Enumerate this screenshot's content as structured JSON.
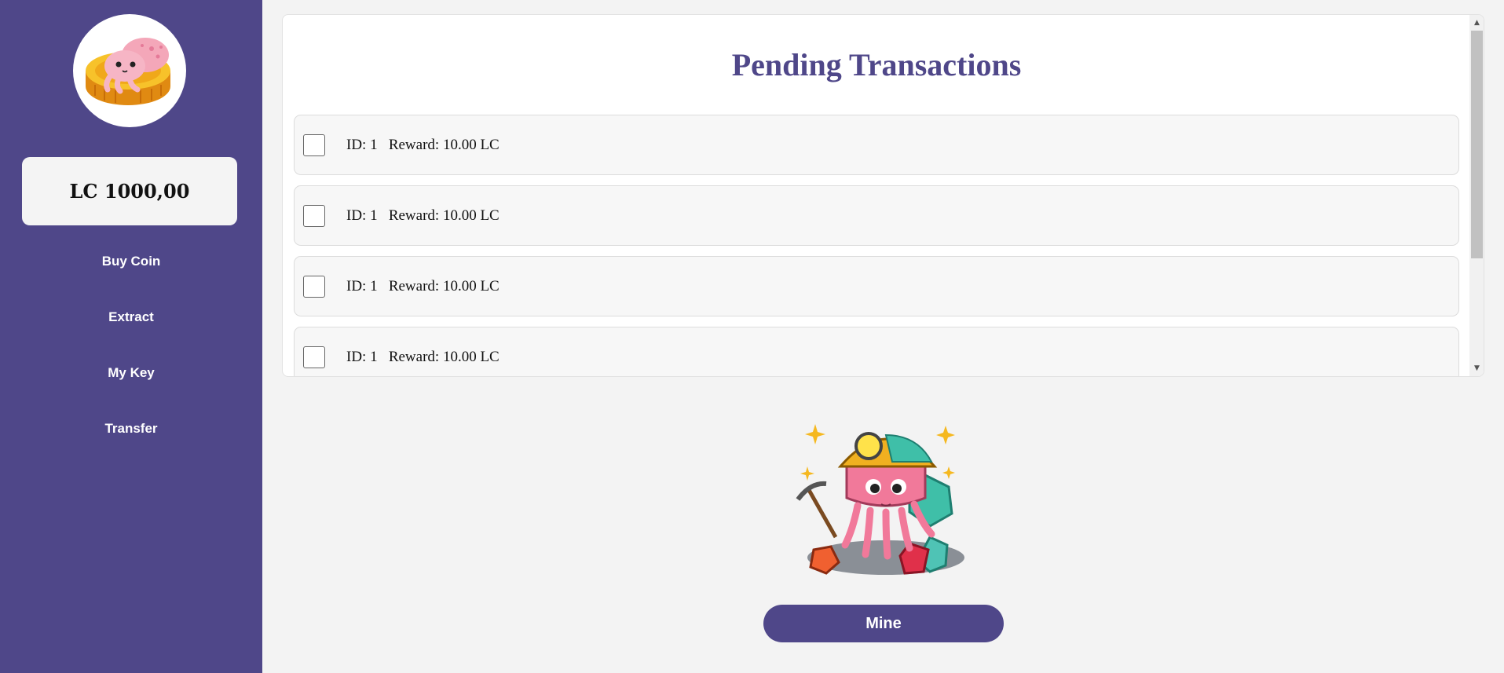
{
  "sidebar": {
    "balance": "LC 1000,00",
    "nav": [
      {
        "label": "Buy Coin"
      },
      {
        "label": "Extract"
      },
      {
        "label": "My Key"
      },
      {
        "label": "Transfer"
      }
    ]
  },
  "panel": {
    "title": "Pending Transactions",
    "transactions": [
      {
        "text": "ID: 1   Reward: 10.00 LC",
        "checked": false
      },
      {
        "text": "ID: 1   Reward: 10.00 LC",
        "checked": false
      },
      {
        "text": "ID: 1   Reward: 10.00 LC",
        "checked": false
      },
      {
        "text": "ID: 1   Reward: 10.00 LC",
        "checked": false
      }
    ]
  },
  "actions": {
    "mine_label": "Mine"
  },
  "colors": {
    "brand": "#4f4789",
    "background": "#f3f3f3"
  },
  "icons": {
    "logo": "squid-on-coin-logo",
    "miner": "squid-miner-illustration"
  }
}
